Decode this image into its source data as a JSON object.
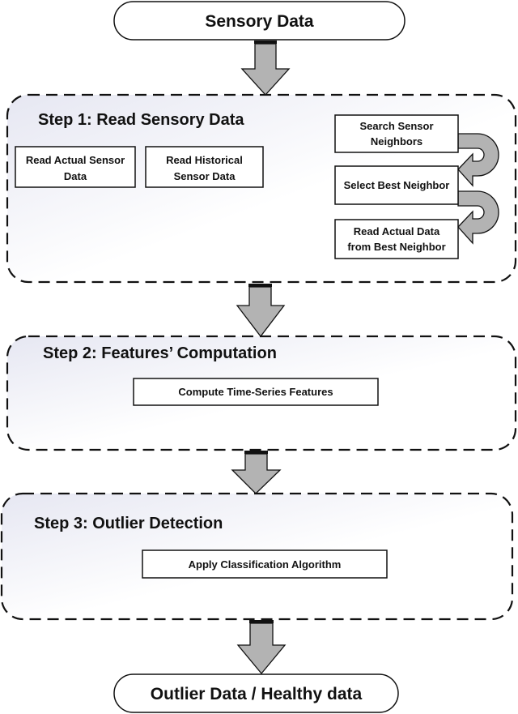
{
  "diagram": {
    "start": {
      "label": "Sensory Data"
    },
    "end": {
      "label": "Outlier Data / Healthy data"
    },
    "steps": [
      {
        "title": "Step 1: Read Sensory Data",
        "left_boxes": [
          {
            "lines": [
              "Read Actual Sensor",
              "Data"
            ]
          },
          {
            "lines": [
              "Read Historical",
              "Sensor Data"
            ]
          }
        ],
        "right_chain": [
          {
            "lines": [
              "Search Sensor",
              "Neighbors"
            ]
          },
          {
            "lines": [
              "Select Best Neighbor"
            ]
          },
          {
            "lines": [
              "Read Actual Data",
              "from Best Neighbor"
            ]
          }
        ]
      },
      {
        "title": "Step 2: Features’ Computation",
        "boxes": [
          {
            "lines": [
              "Compute Time-Series Features"
            ]
          }
        ]
      },
      {
        "title": "Step 3: Outlier Detection",
        "boxes": [
          {
            "lines": [
              "Apply Classification Algorithm"
            ]
          }
        ]
      }
    ],
    "colors": {
      "stage_fill_start": "#e8e9f3",
      "stage_fill_end": "#ffffff",
      "arrow_fill": "#b3b3b3",
      "stroke": "#111111"
    }
  }
}
